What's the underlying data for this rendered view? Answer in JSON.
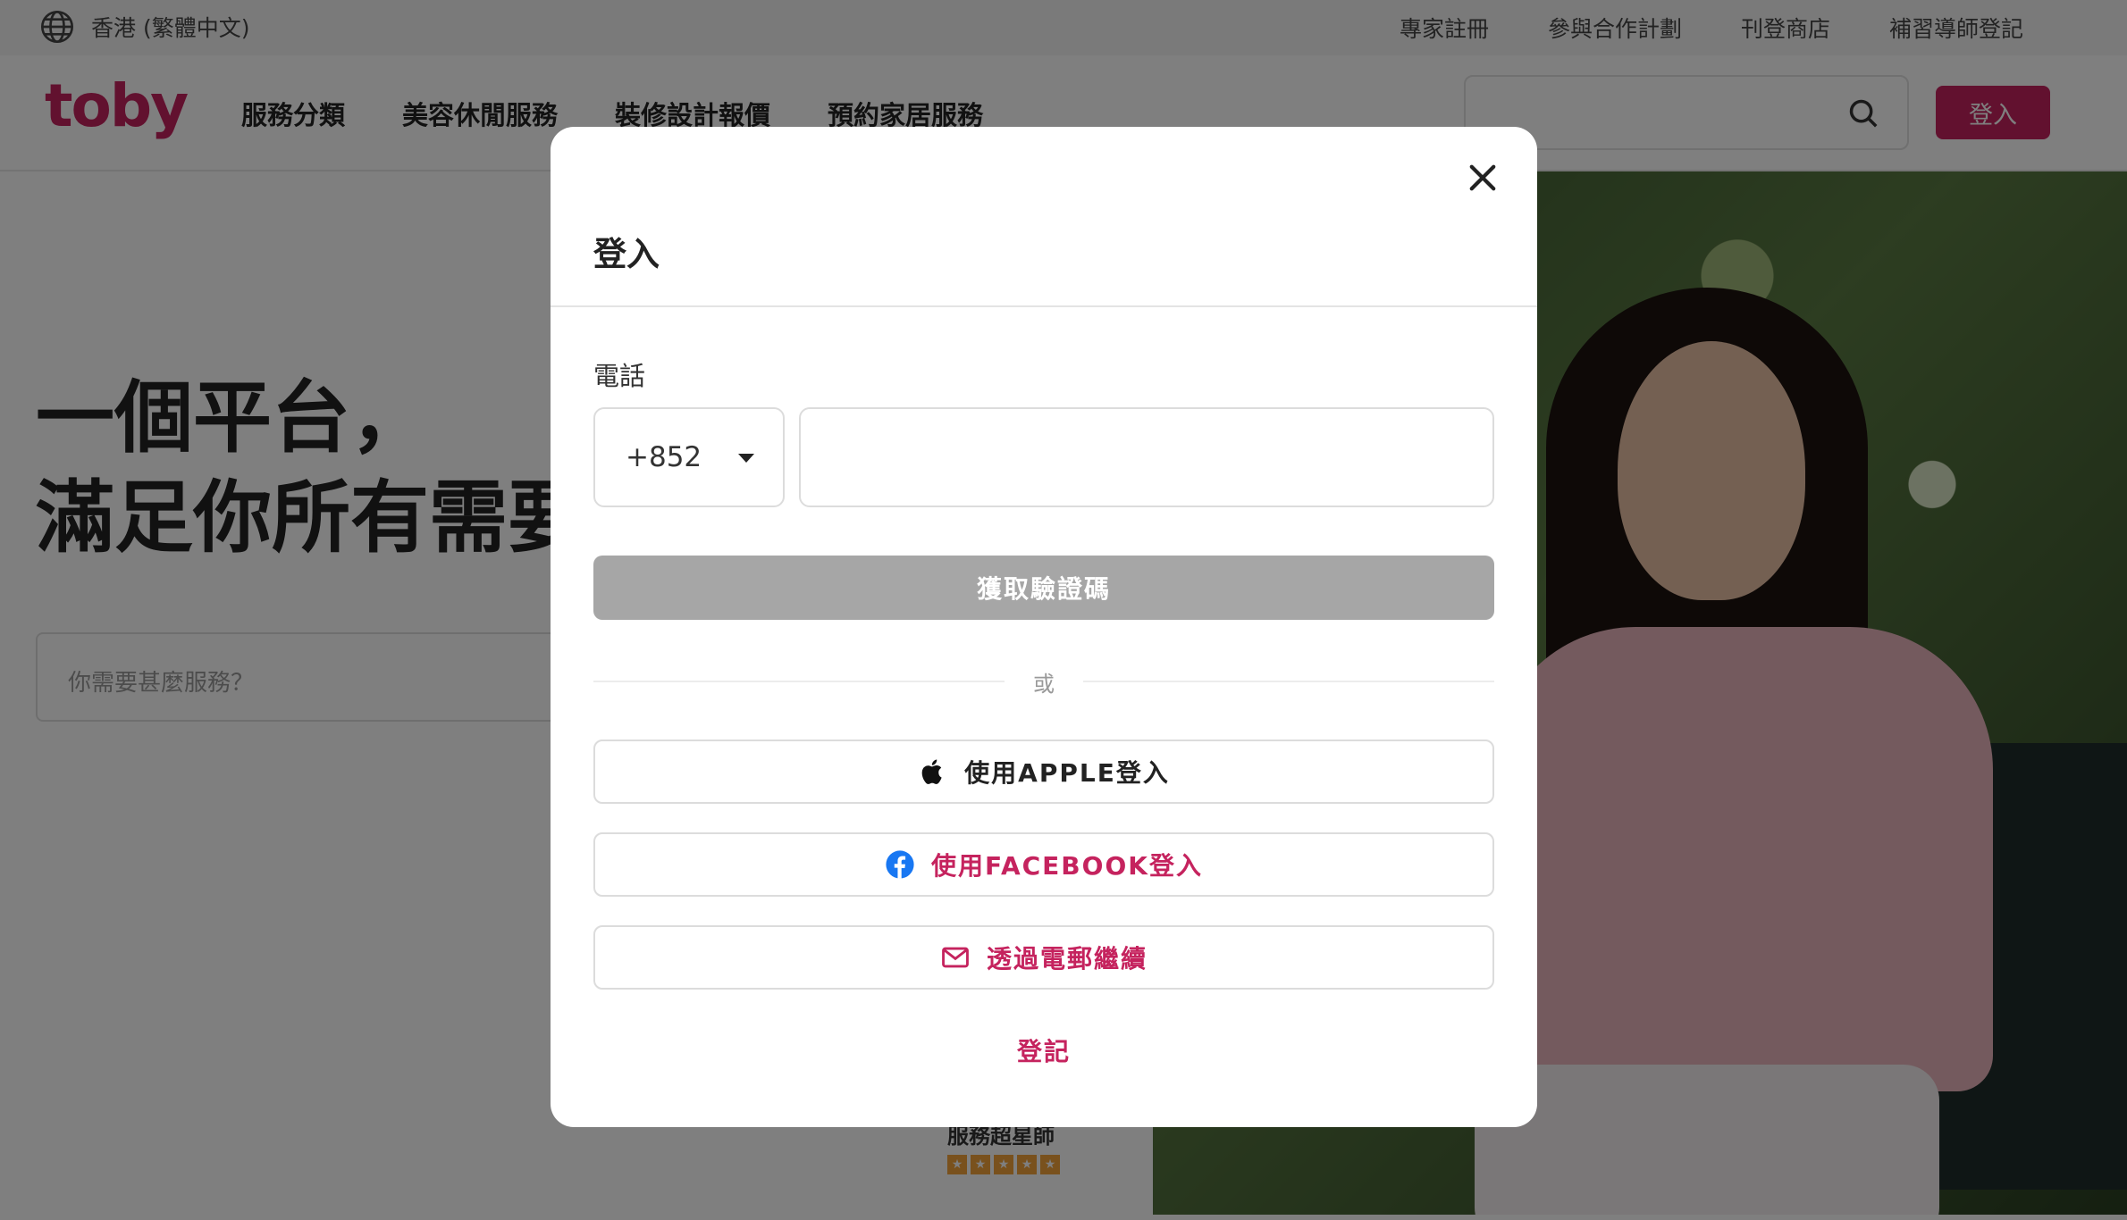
{
  "topbar": {
    "language": "香港 (繁體中文)",
    "links": [
      "專家註冊",
      "參與合作計劃",
      "刊登商店",
      "補習導師登記"
    ]
  },
  "header": {
    "logo": "toby",
    "nav": [
      "服務分類",
      "美容休閒服務",
      "裝修設計報價",
      "預約家居服務"
    ],
    "login_label": "登入"
  },
  "hero": {
    "title_line1": "一個平台，",
    "title_line2": "滿足你所有需要",
    "search_placeholder": "你需要甚麼服務？",
    "rating_text": "服務超星師"
  },
  "modal": {
    "title": "登入",
    "phone_label": "電話",
    "country_code": "+852",
    "phone_value": "",
    "otp_button": "獲取驗證碼",
    "or_text": "或",
    "apple_button": "使用APPLE登入",
    "facebook_button": "使用FACEBOOK登入",
    "email_button": "透過電郵繼續",
    "register_link": "登記"
  },
  "colors": {
    "brand": "#c5235e",
    "disabled_button": "#a6a6a6",
    "facebook": "#1877f2"
  },
  "icons": [
    "globe-icon",
    "search-icon",
    "close-icon",
    "chevron-down-icon",
    "apple-icon",
    "facebook-icon",
    "mail-icon",
    "star-icon"
  ]
}
